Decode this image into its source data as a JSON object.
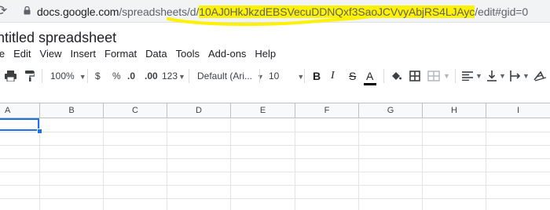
{
  "browser": {
    "url_host": "docs.google.com",
    "url_path_prefix": "/spreadsheets/d/",
    "url_sheet_id": "10AJ0HkJkzdEBSVecuDDNQxf3SaoJCVvyAbjRS4LJAyc",
    "url_suffix": "/edit#gid=0",
    "highlight_color": "#fff200"
  },
  "document": {
    "title": "ntitled spreadsheet"
  },
  "menu": [
    "le",
    "Edit",
    "View",
    "Insert",
    "Format",
    "Data",
    "Tools",
    "Add-ons",
    "Help"
  ],
  "toolbar": {
    "zoom": "100%",
    "currency": "$",
    "percent": "%",
    "decrease_decimal": ".0",
    "increase_decimal": ".00",
    "more_formats": "123",
    "font": "Default (Ari...",
    "font_size": "10",
    "bold": "B",
    "italic": "I",
    "strike": "S",
    "text_color": "A"
  },
  "sheet": {
    "columns": [
      "A",
      "B",
      "C",
      "D",
      "E",
      "F",
      "G",
      "H",
      "I"
    ],
    "selected_cell": "A1",
    "accent": "#1a73e8"
  }
}
